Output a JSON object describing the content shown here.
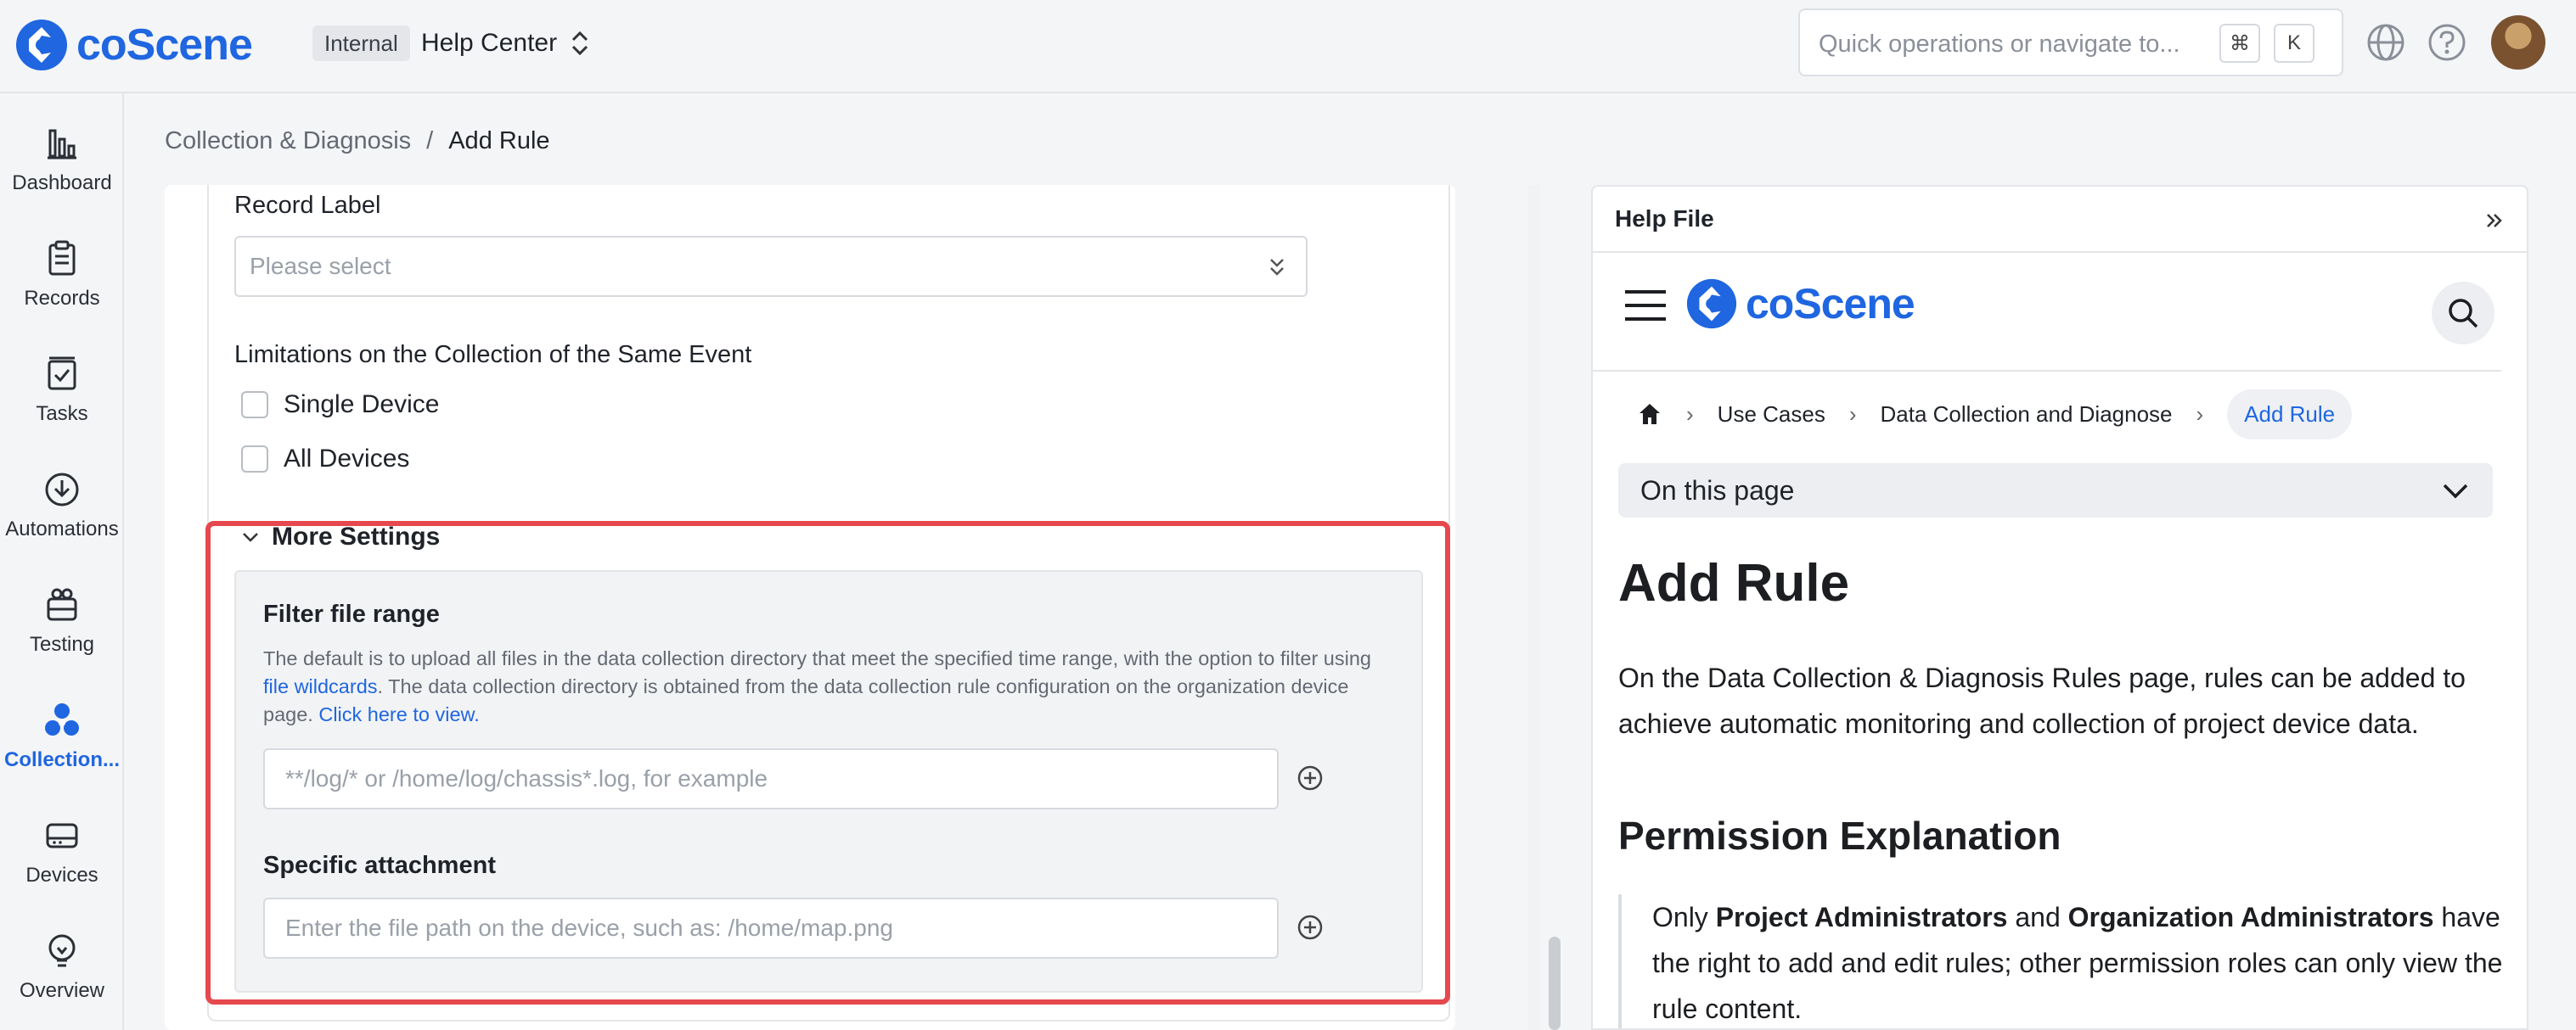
{
  "app": {
    "logo_text": "coScene",
    "brand_color": "#1f66e0"
  },
  "header": {
    "org_tag": "Internal",
    "org_name": "Help Center",
    "search_placeholder": "Quick operations or navigate to...",
    "shortcut_keys": [
      "⌘",
      "K"
    ]
  },
  "sidebar": {
    "items": [
      {
        "label": "Dashboard",
        "icon": "bar-chart-icon"
      },
      {
        "label": "Records",
        "icon": "clipboard-icon"
      },
      {
        "label": "Tasks",
        "icon": "task-check-icon"
      },
      {
        "label": "Automations",
        "icon": "automation-icon"
      },
      {
        "label": "Testing",
        "icon": "testing-icon"
      },
      {
        "label": "Collection...",
        "icon": "collection-icon",
        "active": true
      },
      {
        "label": "Devices",
        "icon": "device-icon"
      },
      {
        "label": "Overview",
        "icon": "lightbulb-icon"
      }
    ]
  },
  "breadcrumb": {
    "parent": "Collection & Diagnosis",
    "separator": "/",
    "current": "Add Rule"
  },
  "form": {
    "record_label": {
      "label": "Record Label",
      "placeholder": "Please select"
    },
    "limitations": {
      "label": "Limitations on the Collection of the Same Event",
      "options": [
        {
          "label": "Single Device",
          "checked": false
        },
        {
          "label": "All Devices",
          "checked": false
        }
      ]
    },
    "more_settings": {
      "label": "More Settings",
      "expanded": true,
      "filter": {
        "title": "Filter file range",
        "desc_part1": "The default is to upload all files in the data collection directory that meet the specified time range, with the option to filter using ",
        "desc_link1": "file wildcards",
        "desc_part2": ". The data collection directory is obtained from the data collection rule configuration on the organization device page. ",
        "desc_link2": "Click here to view.",
        "placeholder": "**/log/* or /home/log/chassis*.log, for example"
      },
      "attachment": {
        "title": "Specific attachment",
        "placeholder": "Enter the file path on the device, such as: /home/map.png"
      }
    }
  },
  "help_panel": {
    "title": "Help File",
    "doc_logo_text": "coScene",
    "crumbs": [
      "Use Cases",
      "Data Collection and Diagnose",
      "Add Rule"
    ],
    "toc_label": "On this page",
    "h1": "Add Rule",
    "intro": "On the Data Collection & Diagnosis Rules page, rules can be added to achieve automatic monitoring and collection of project device data.",
    "h2": "Permission Explanation",
    "quote": {
      "p1": "Only ",
      "b1": "Project Administrators",
      "p2": " and ",
      "b2": "Organization Administrators",
      "p3": " have the right to add and edit rules; other permission roles can only view the rule content."
    }
  },
  "colors": {
    "highlight": "#e5484d",
    "link": "#1f66e0"
  }
}
